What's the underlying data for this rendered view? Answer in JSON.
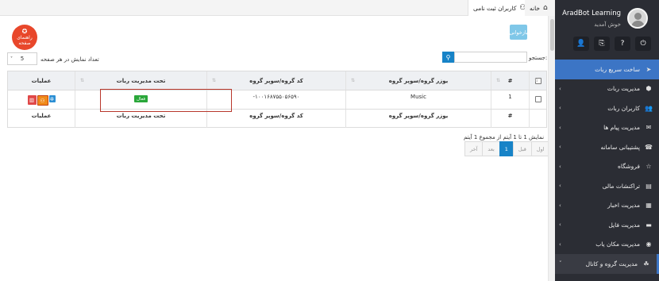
{
  "sidebar": {
    "user_name": "AradBot Learning",
    "welcome": "خوش آمدید",
    "actions": [
      {
        "icon": "user-group-icon",
        "glyph": "👤"
      },
      {
        "icon": "document-icon",
        "glyph": "⎘"
      },
      {
        "icon": "help-circle-icon",
        "glyph": "?"
      },
      {
        "icon": "power-icon",
        "glyph": "⏻"
      }
    ],
    "menu": [
      {
        "label": "ساخت سریع ربات",
        "icon": "rocket-icon",
        "glyph": "➤",
        "state": "active",
        "arrow": ""
      },
      {
        "label": "مدیریت ربات",
        "icon": "android-icon",
        "glyph": "⬢",
        "state": "",
        "arrow": "‹"
      },
      {
        "label": "کاربران ربات",
        "icon": "users-icon",
        "glyph": "👥",
        "state": "",
        "arrow": "‹"
      },
      {
        "label": "مدیریت پیام ها",
        "icon": "envelope-icon",
        "glyph": "✉",
        "state": "",
        "arrow": "‹"
      },
      {
        "label": "پشتیبانی سامانه",
        "icon": "support-icon",
        "glyph": "☎",
        "state": "",
        "arrow": "‹"
      },
      {
        "label": "فروشگاه",
        "icon": "store-icon",
        "glyph": "☆",
        "state": "",
        "arrow": "‹"
      },
      {
        "label": "تراکنشات مالی",
        "icon": "transactions-icon",
        "glyph": "▤",
        "state": "",
        "arrow": "‹"
      },
      {
        "label": "مدیریت اخبار",
        "icon": "news-icon",
        "glyph": "▦",
        "state": "",
        "arrow": "‹"
      },
      {
        "label": "مدیریت فایل",
        "icon": "folder-icon",
        "glyph": "▬",
        "state": "",
        "arrow": "‹"
      },
      {
        "label": "مدیریت مکان یاب",
        "icon": "location-icon",
        "glyph": "◉",
        "state": "",
        "arrow": "‹"
      },
      {
        "label": "مدیریت گروه و کانال",
        "icon": "group-icon",
        "glyph": "☘",
        "state": "open",
        "arrow": "˅"
      }
    ]
  },
  "tabs": {
    "home": "خانه",
    "registered_users": "کاربران ثبت نامی"
  },
  "help_button": {
    "line1": "راهنمای",
    "line2": "صفحه"
  },
  "back_button": "بازخوانی",
  "controls": {
    "page_size_label": "تعداد نمایش در هر صفحه",
    "page_size_value": "5",
    "search_label": "جستجو:",
    "search_value": ""
  },
  "table": {
    "headers": {
      "num": "#",
      "user": "یوزر گروه/سوپر گروه",
      "code": "کد گروه/سوپر گروه",
      "mgmt": "تحت مدیریت ربات",
      "ops": "عملیات"
    },
    "row": {
      "num": "1",
      "user": "Music",
      "code": "-۱۰۰۱۶۸۷۵۵۰۵۶۵۹۰",
      "status": "فعال"
    },
    "footer": {
      "num": "#",
      "user": "یوزر گروه/سوپر گروه",
      "code": "کد گروه/سوپر گروه",
      "mgmt": "تحت مدیریت ربات",
      "ops": "عملیات"
    }
  },
  "info": "نمایش 1 تا 1 آیتم از مجموع 1 آیتم",
  "pagination": {
    "first": "اول",
    "prev": "قبل",
    "current": "1",
    "next": "بعد",
    "last": "آخر"
  }
}
